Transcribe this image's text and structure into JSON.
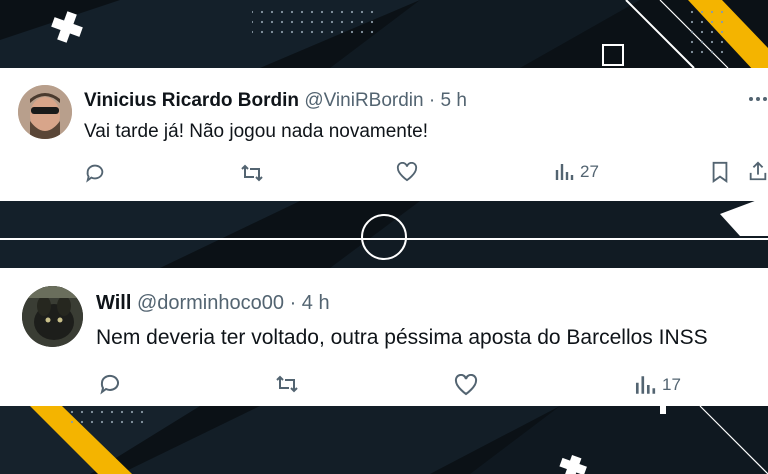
{
  "colors": {
    "background": "#0b1116",
    "accent": "#f4b400",
    "card": "#ffffff",
    "text": "#0f1419",
    "muted": "#536471"
  },
  "tweets": [
    {
      "name": "Vinicius Ricardo Bordin",
      "handle": "@ViniRBordin",
      "separator": "·",
      "time": "5 h",
      "text": "Vai tarde já! Não jogou nada novamente!",
      "views": "27",
      "more_icon": "more-horizontal-icon"
    },
    {
      "name": "Will",
      "handle": "@dorminhoco00",
      "separator": "·",
      "time": "4 h",
      "text": "Nem deveria ter voltado, outra péssima aposta do Barcellos INSS",
      "views": "17"
    }
  ]
}
